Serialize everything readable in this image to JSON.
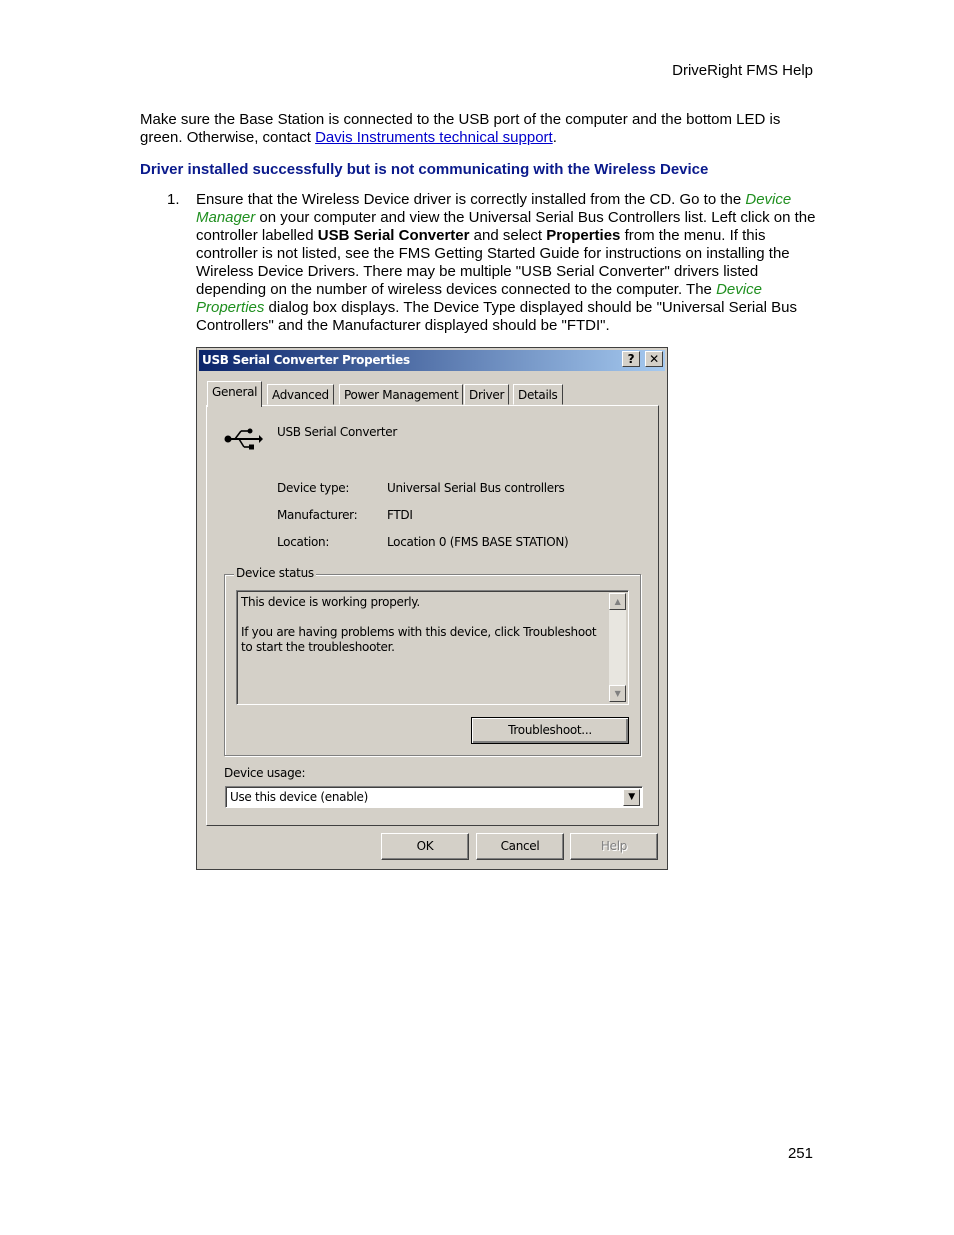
{
  "header": {
    "title": "DriveRight FMS Help"
  },
  "intro": {
    "text_before_link": "Make sure the Base Station is connected to the USB port of the computer and the bottom LED is green. Otherwise, contact ",
    "link_text": "Davis Instruments technical support",
    "text_after_link": "."
  },
  "subheading": "Driver installed successfully but is not communicating with the Wireless Device",
  "step1": {
    "number": "1.",
    "t1": "Ensure that the Wireless Device driver is correctly installed from the CD. Go to the ",
    "em1": "Device Manager",
    "t2": " on your computer and view the Universal Serial Bus Controllers list. Left click on the controller labelled ",
    "b1": "USB Serial Converter",
    "t3": " and select ",
    "b2": "Properties",
    "t4": " from the menu. If this controller is not listed, see the FMS Getting Started Guide for instructions on installing the Wireless Device Drivers. There may be multiple \"USB Serial Converter\" drivers listed depending on the number of wireless devices connected to the computer. The ",
    "em2": "Device Properties",
    "t5": " dialog box displays. The Device Type displayed should be \"Universal Serial Bus Controllers\" and the Manufacturer displayed should be \"FTDI\"."
  },
  "dialog": {
    "title": "USB Serial Converter Properties",
    "help_btn": "?",
    "close_btn": "✕",
    "tabs": [
      "General",
      "Advanced",
      "Power Management",
      "Driver",
      "Details"
    ],
    "device_name": "USB Serial Converter",
    "device_icon": "usb-icon",
    "props": [
      {
        "label": "Device type:",
        "value": "Universal Serial Bus controllers"
      },
      {
        "label": "Manufacturer:",
        "value": "FTDI"
      },
      {
        "label": "Location:",
        "value": "Location 0 (FMS BASE STATION)"
      }
    ],
    "status_group": "Device status",
    "status_line1": "This device is working properly.",
    "status_line2": "If you are having problems with this device, click Troubleshoot to start the troubleshooter.",
    "troubleshoot_btn": "Troubleshoot...",
    "usage_label": "Device usage:",
    "usage_value": "Use this device (enable)",
    "ok": "OK",
    "cancel": "Cancel",
    "help": "Help"
  },
  "page_number": "251"
}
